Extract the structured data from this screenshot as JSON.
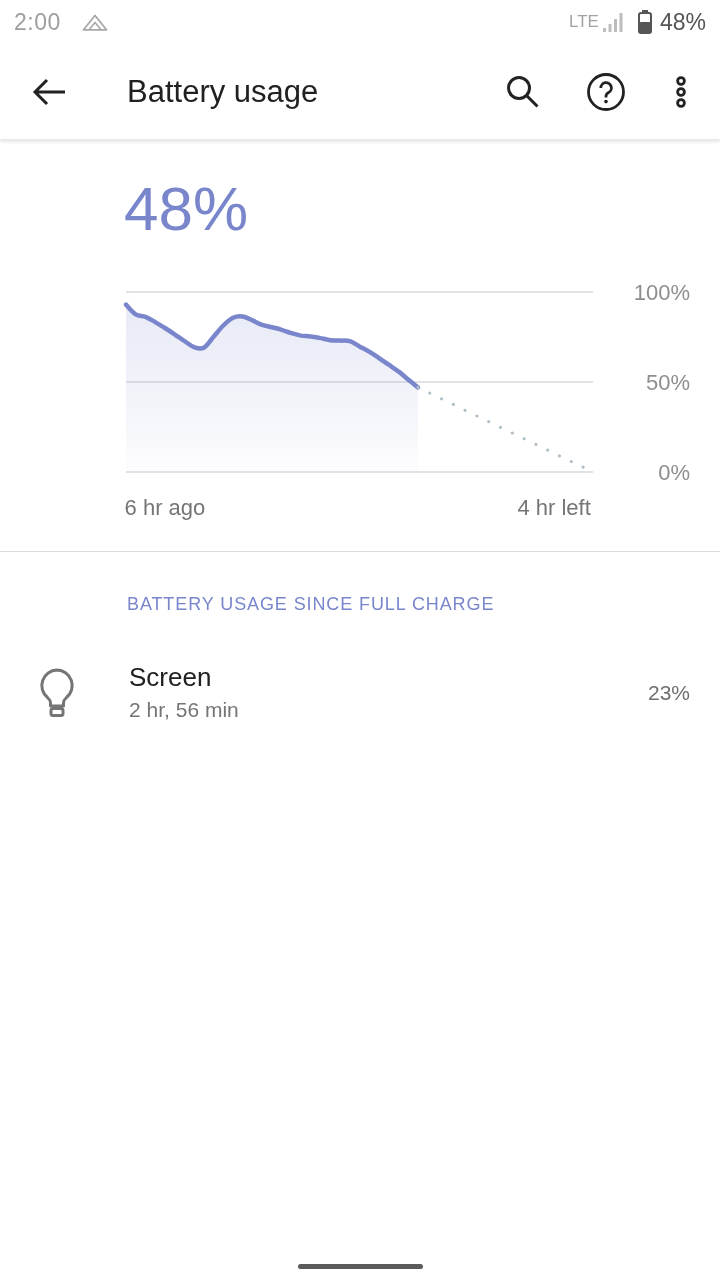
{
  "status_bar": {
    "time": "2:00",
    "network": "LTE",
    "battery": "48%"
  },
  "app_bar": {
    "title": "Battery usage"
  },
  "battery_level": "48%",
  "chart": {
    "chart_data": {
      "type": "area",
      "categories": [
        null,
        null,
        null,
        null,
        "6 hr ago",
        null,
        null,
        null,
        null,
        null,
        null,
        null,
        null,
        null,
        null,
        null,
        null,
        null,
        null,
        null,
        null,
        null,
        null,
        null,
        null,
        null,
        null,
        null,
        null,
        null,
        null,
        null,
        null,
        null,
        null,
        null,
        null,
        null,
        null,
        null,
        null,
        null,
        null,
        null,
        "4 hr left",
        null,
        null,
        null,
        null
      ],
      "series": [
        {
          "color": "#7986cb",
          "line_style": "solid",
          "values": [
            93,
            87.6,
            86.2,
            83.3,
            80,
            76.5,
            72.8,
            69.4,
            69,
            75.1,
            81.4,
            85.7,
            86.4,
            84.2,
            81.7,
            80.4,
            79,
            77.1,
            75.8,
            75.3,
            74.4,
            73.2,
            73,
            72.7,
            69.8,
            66.9,
            63.3,
            59.6,
            55.9,
            51.4,
            47,
            null,
            null,
            null,
            null,
            null,
            null,
            null,
            null,
            null,
            null,
            null,
            null,
            null,
            null,
            null,
            null,
            null,
            null
          ]
        },
        {
          "type": "line",
          "color": "#b0bec5",
          "line_style": "dotted",
          "values": [
            null,
            null,
            null,
            null,
            null,
            null,
            null,
            null,
            null,
            null,
            null,
            null,
            null,
            null,
            null,
            null,
            null,
            null,
            null,
            null,
            null,
            null,
            null,
            null,
            null,
            null,
            null,
            null,
            null,
            null,
            47,
            44.4,
            41.8,
            39.2,
            36.6,
            33.9,
            31.3,
            28.7,
            26.1,
            23.5,
            20.9,
            18.3,
            15.7,
            13.1,
            10.4,
            7.8,
            5.2,
            2.6,
            0
          ]
        }
      ],
      "ylim": [
        0,
        100
      ],
      "yticks": [
        {
          "value": 100,
          "label": "100%"
        },
        {
          "value": 50,
          "label": "50%"
        },
        {
          "value": 0,
          "label": "0%"
        }
      ]
    }
  },
  "usage_section": {
    "header": "BATTERY USAGE SINCE FULL CHARGE",
    "items": [
      {
        "name": "Screen",
        "duration": "2 hr, 56 min",
        "percent": "23%"
      }
    ]
  }
}
